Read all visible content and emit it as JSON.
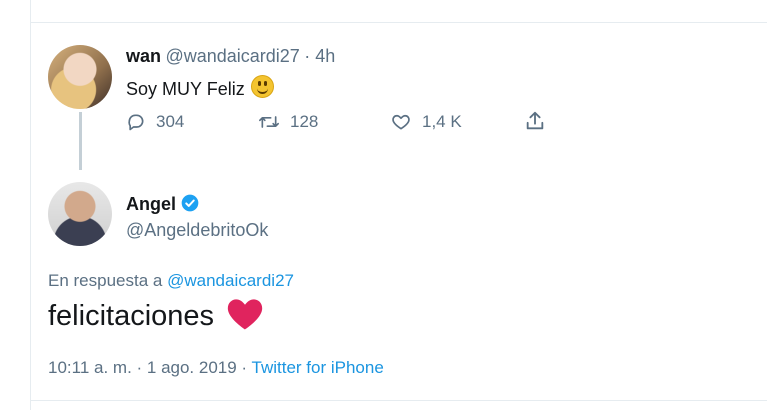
{
  "parent_tweet": {
    "name": "wan",
    "handle": "@wandaicardi27",
    "time": "· 4h",
    "text": "Soy MUY Feliz",
    "replies": "304",
    "retweets": "128",
    "likes": "1,4 K"
  },
  "reply_tweet": {
    "name": "Angel",
    "handle": "@AngeldebritoOk",
    "reply_prefix": "En respuesta a",
    "reply_to": "@wandaicardi27",
    "text": "felicitaciones",
    "date": "10:11 a. m. · 1 ago. 2019 ·",
    "source": "Twitter for iPhone"
  },
  "icons": {
    "reply": "reply-icon",
    "retweet": "retweet-icon",
    "like": "heart-icon",
    "share": "share-icon",
    "verified": "verified-badge-icon",
    "emoji_smile": "smiley-emoji",
    "emoji_heart": "red-heart-emoji"
  },
  "colors": {
    "link": "#1b95e0",
    "muted": "#5b7083",
    "heart": "#e0245e"
  }
}
